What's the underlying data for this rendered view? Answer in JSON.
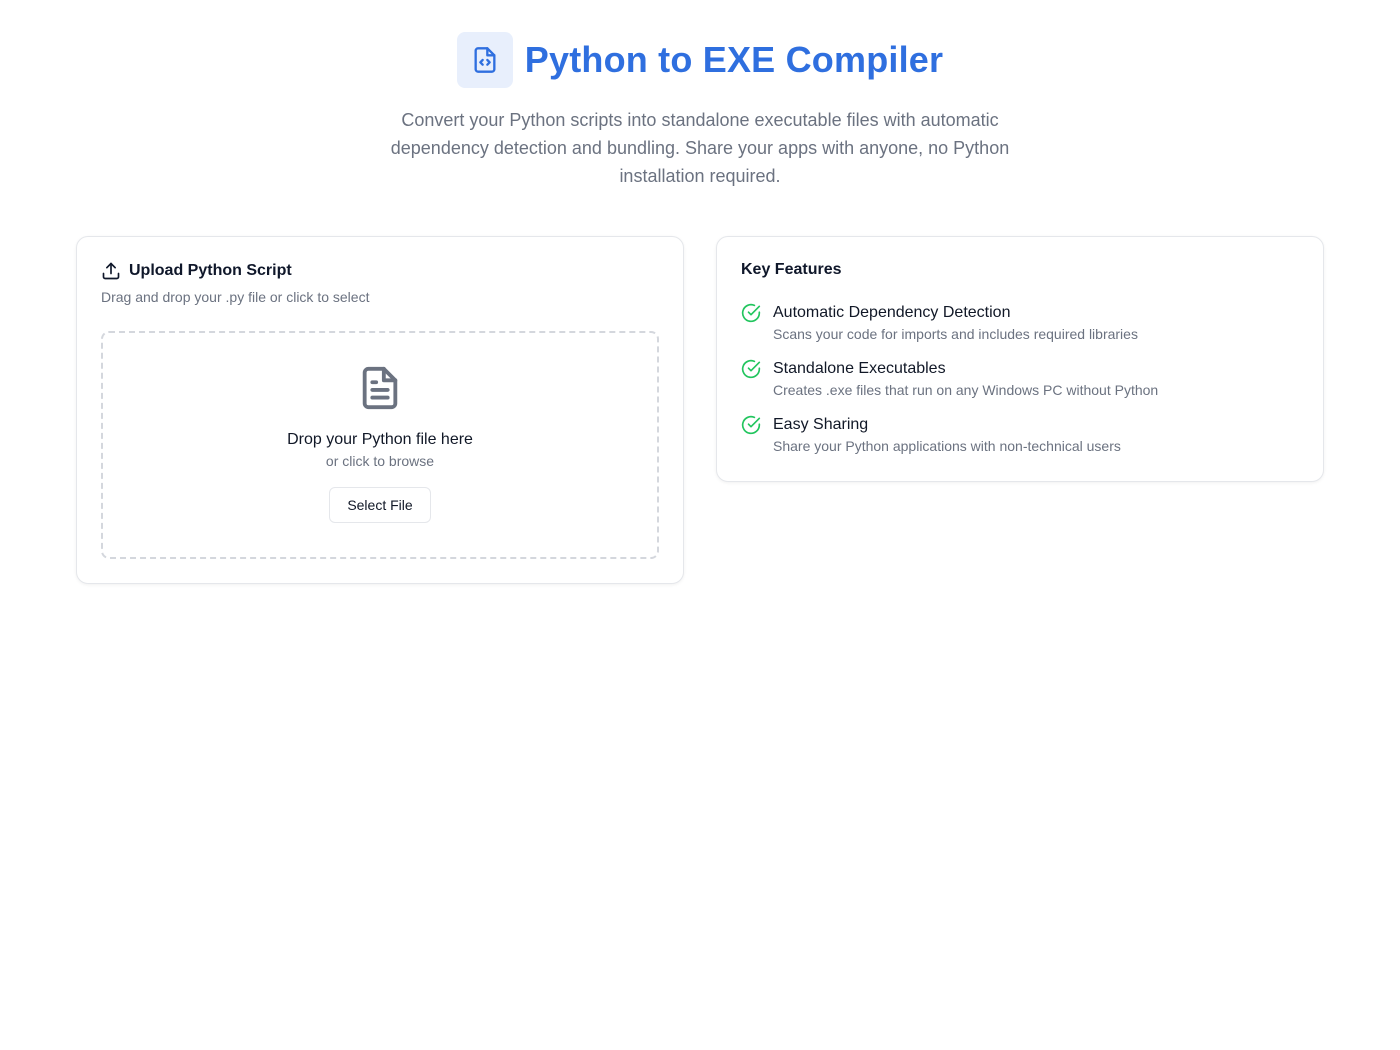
{
  "header": {
    "title": "Python to EXE Compiler",
    "subtitle": "Convert your Python scripts into standalone executable files with automatic dependency detection and bundling. Share your apps with anyone, no Python installation required.",
    "logo_icon": "file-code-icon",
    "accent_color": "#2f6fdf"
  },
  "upload": {
    "icon": "upload-icon",
    "title": "Upload Python Script",
    "description": "Drag and drop your .py file or click to select",
    "dropzone": {
      "icon": "file-text-icon",
      "title": "Drop your Python file here",
      "subtitle": "or click to browse",
      "button_label": "Select File"
    }
  },
  "features": {
    "title": "Key Features",
    "check_color": "#22c55e",
    "items": [
      {
        "icon": "check-circle-icon",
        "name": "Automatic Dependency Detection",
        "description": "Scans your code for imports and includes required libraries"
      },
      {
        "icon": "check-circle-icon",
        "name": "Standalone Executables",
        "description": "Creates .exe files that run on any Windows PC without Python"
      },
      {
        "icon": "check-circle-icon",
        "name": "Easy Sharing",
        "description": "Share your Python applications with non-technical users"
      }
    ]
  }
}
